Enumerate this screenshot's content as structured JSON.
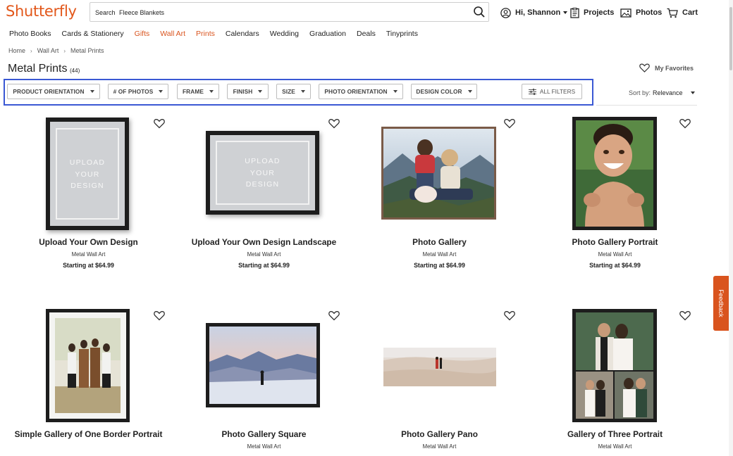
{
  "header": {
    "logo": "Shutterfly",
    "search": {
      "label": "Search",
      "value": "Fleece Blankets"
    },
    "account_label": "Hi, Shannon",
    "projects_label": "Projects",
    "photos_label": "Photos",
    "cart_label": "Cart"
  },
  "nav": [
    {
      "label": "Photo Books",
      "accent": false
    },
    {
      "label": "Cards & Stationery",
      "accent": false
    },
    {
      "label": "Gifts",
      "accent": true
    },
    {
      "label": "Wall Art",
      "accent": true
    },
    {
      "label": "Prints",
      "accent": true
    },
    {
      "label": "Calendars",
      "accent": false
    },
    {
      "label": "Wedding",
      "accent": false
    },
    {
      "label": "Graduation",
      "accent": false
    },
    {
      "label": "Deals",
      "accent": false
    },
    {
      "label": "Tinyprints",
      "accent": false
    }
  ],
  "breadcrumb": [
    "Home",
    "Wall Art",
    "Metal Prints"
  ],
  "page": {
    "title": "Metal Prints",
    "count": "(44)",
    "favorites_label": "My Favorites"
  },
  "filters": [
    "PRODUCT ORIENTATION",
    "# OF PHOTOS",
    "FRAME",
    "FINISH",
    "SIZE",
    "PHOTO ORIENTATION",
    "DESIGN COLOR"
  ],
  "all_filters_label": "ALL FILTERS",
  "sort": {
    "label": "Sort by:",
    "value": "Relevance"
  },
  "upload_text": [
    "UPLOAD",
    "YOUR",
    "DESIGN"
  ],
  "products": [
    {
      "title": "Upload Your Own Design",
      "subtitle": "Metal Wall Art",
      "price": "Starting at $64.99"
    },
    {
      "title": "Upload Your Own Design Landscape",
      "subtitle": "Metal Wall Art",
      "price": "Starting at $64.99"
    },
    {
      "title": "Photo Gallery",
      "subtitle": "Metal Wall Art",
      "price": "Starting at $64.99"
    },
    {
      "title": "Photo Gallery Portrait",
      "subtitle": "Metal Wall Art",
      "price": "Starting at $64.99"
    },
    {
      "title": "Simple Gallery of One Border Portrait",
      "subtitle": "",
      "price": ""
    },
    {
      "title": "Photo Gallery Square",
      "subtitle": "Metal Wall Art",
      "price": ""
    },
    {
      "title": "Photo Gallery Pano",
      "subtitle": "Metal Wall Art",
      "price": ""
    },
    {
      "title": "Gallery of Three Portrait",
      "subtitle": "Metal Wall Art",
      "price": ""
    }
  ],
  "feedback_label": "Feedback",
  "colors": {
    "brand": "#e2571a",
    "accent": "#d9541e",
    "filter_highlight": "#3a58d4"
  }
}
